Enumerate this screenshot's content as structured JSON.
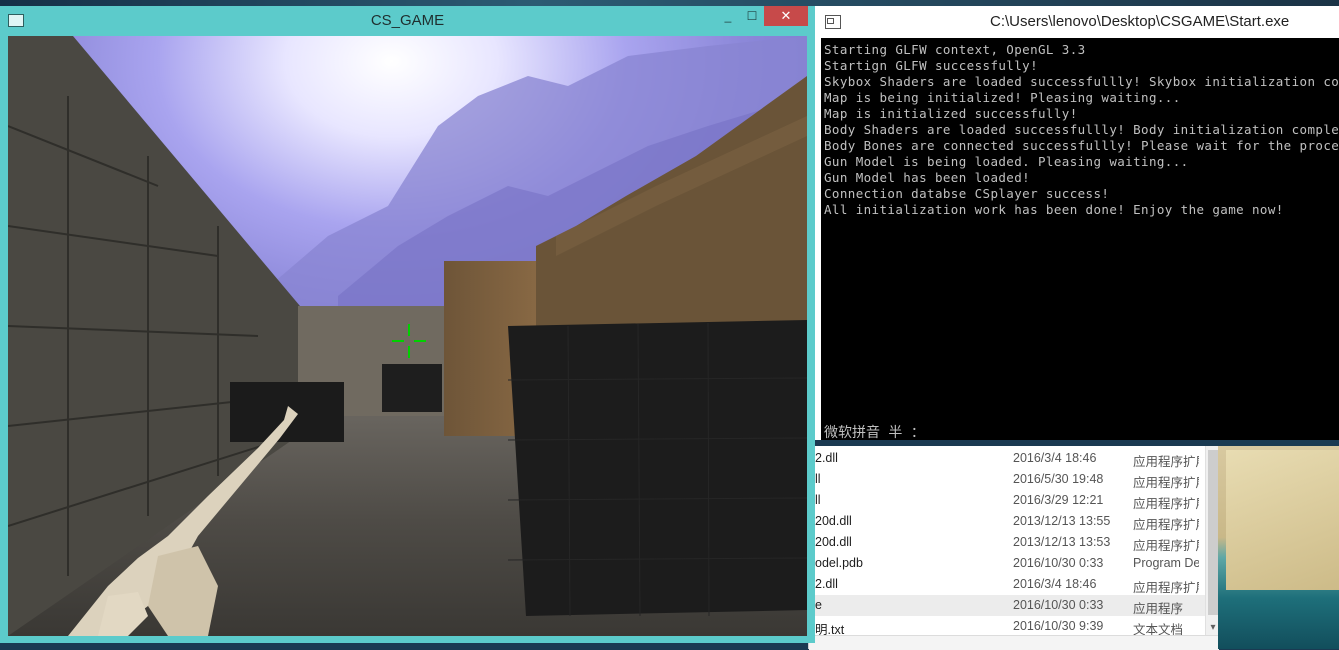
{
  "game_window": {
    "title": "CS_GAME",
    "controls": {
      "minimize": "_",
      "maximize": "☐",
      "close": "✕"
    }
  },
  "console_window": {
    "title": "C:\\Users\\lenovo\\Desktop\\CSGAME\\Start.exe",
    "lines": [
      "Starting GLFW context, OpenGL 3.3",
      "Startign GLFW successfully!",
      "Skybox Shaders are loaded successfullly! Skybox initialization co",
      "Map is being initialized! Pleasing waiting...",
      "Map is initialized successfully!",
      "Body Shaders are loaded successfullly! Body initialization comple",
      "Body Bones are connected successfullly! Please wait for the proce",
      "Gun Model is being loaded. Pleasing waiting...",
      "Gun Model has been loaded!",
      "Connection databse CSplayer success!",
      "All initialization work has been done! Enjoy the game now!"
    ],
    "ime_status": "微软拼音 半 ："
  },
  "explorer": {
    "rows": [
      {
        "name": "2.dll",
        "date": "2016/3/4 18:46",
        "type": "应用程序扩展"
      },
      {
        "name": "ll",
        "date": "2016/5/30 19:48",
        "type": "应用程序扩展"
      },
      {
        "name": "ll",
        "date": "2016/3/29 12:21",
        "type": "应用程序扩展"
      },
      {
        "name": "20d.dll",
        "date": "2013/12/13 13:55",
        "type": "应用程序扩展"
      },
      {
        "name": "20d.dll",
        "date": "2013/12/13 13:53",
        "type": "应用程序扩展"
      },
      {
        "name": "odel.pdb",
        "date": "2016/10/30 0:33",
        "type": "Program Debug"
      },
      {
        "name": "2.dll",
        "date": "2016/3/4 18:46",
        "type": "应用程序扩展"
      },
      {
        "name": "e",
        "date": "2016/10/30 0:33",
        "type": "应用程序"
      },
      {
        "name": "明.txt",
        "date": "2016/10/30 9:39",
        "type": "文本文档"
      }
    ],
    "selected_index": 7
  },
  "colors": {
    "game_frame": "#5ccbcb",
    "close_button": "#c74a4a",
    "console_bg": "#000000",
    "console_text": "#c0c0c0",
    "crosshair": "#00d000"
  }
}
